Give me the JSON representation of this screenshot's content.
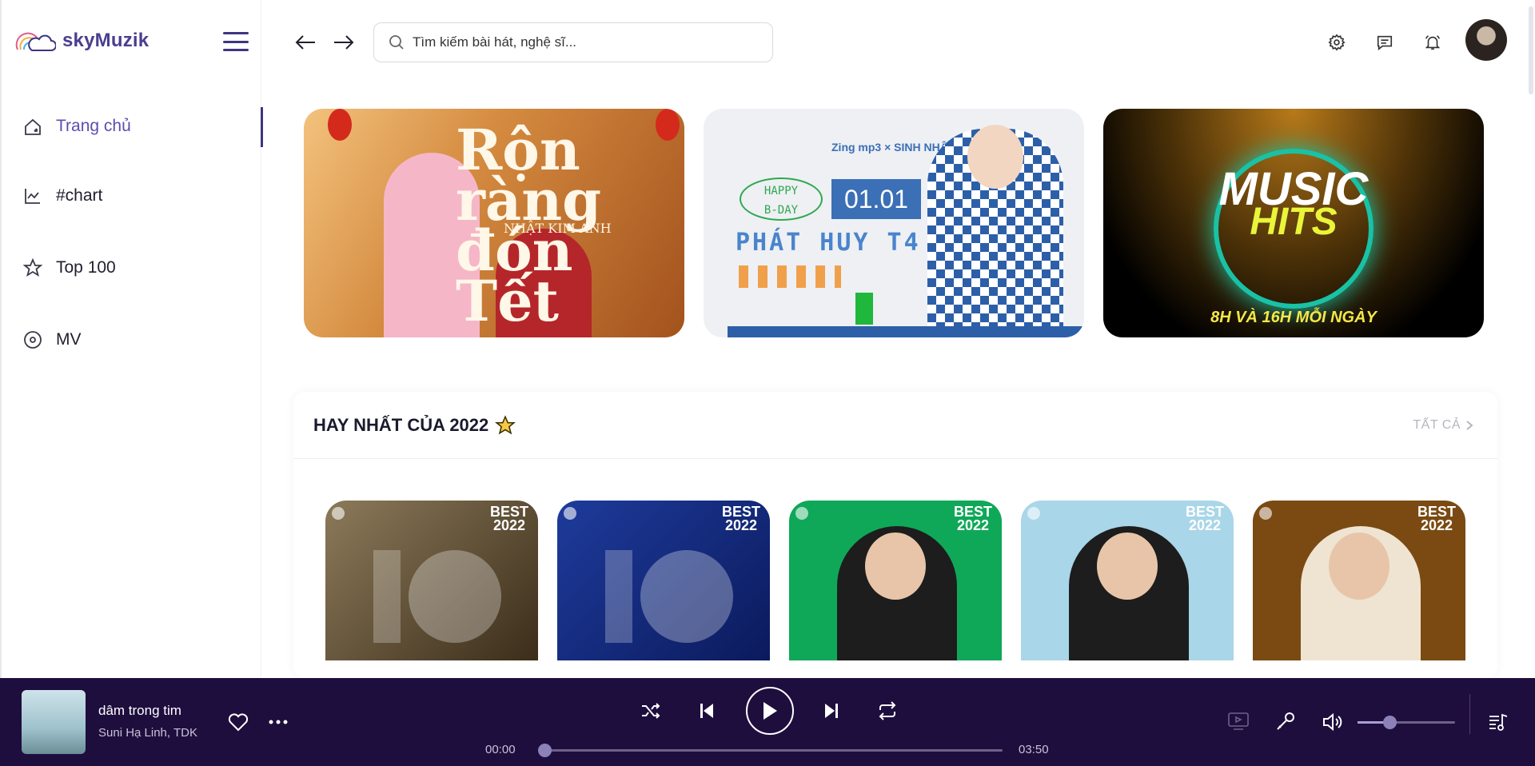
{
  "app": {
    "name": "skyMuzik"
  },
  "sidebar": {
    "items": [
      {
        "label": "Trang chủ",
        "icon": "home-icon",
        "active": true
      },
      {
        "label": "#chart",
        "icon": "chart-icon",
        "active": false
      },
      {
        "label": "Top 100",
        "icon": "star-icon",
        "active": false
      },
      {
        "label": "MV",
        "icon": "disc-icon",
        "active": false
      }
    ]
  },
  "header": {
    "search": {
      "placeholder": "Tìm kiếm bài hát, nghệ sĩ..."
    }
  },
  "banners": [
    {
      "title_line1": "Rộn ràng",
      "title_line2": "đón Tết",
      "artist": "NHẬT KIM ANH"
    },
    {
      "brand": "Zing mp3 × SINH NHẬT SAO",
      "greeting_line1": "HAPPY",
      "greeting_line2": "B-DAY",
      "date": "01.01",
      "name": "PHÁT HUY T4"
    },
    {
      "title_line1": "MUSIC",
      "title_line2": "HITS",
      "schedule": "8H VÀ 16H MỖI NGÀY"
    }
  ],
  "section": {
    "title": "HAY NHẤT CỦA 2022",
    "see_all": "TẤT CẢ",
    "cards": [
      {
        "badge_line1": "BEST",
        "badge_line2": "2022"
      },
      {
        "badge_line1": "BEST",
        "badge_line2": "2022"
      },
      {
        "badge_line1": "BEST",
        "badge_line2": "2022"
      },
      {
        "badge_line1": "BEST",
        "badge_line2": "2022"
      },
      {
        "badge_line1": "BEST",
        "badge_line2": "2022"
      }
    ]
  },
  "player": {
    "title": "dâm trong tim",
    "artist": "Suni Hạ Linh, TDK",
    "current_time": "00:00",
    "duration": "03:50",
    "progress": 0,
    "volume": 0.33
  },
  "colors": {
    "brand": "#4a3f8f",
    "player_bg": "#1e0e3e",
    "active_nav": "#5b4fb0"
  }
}
